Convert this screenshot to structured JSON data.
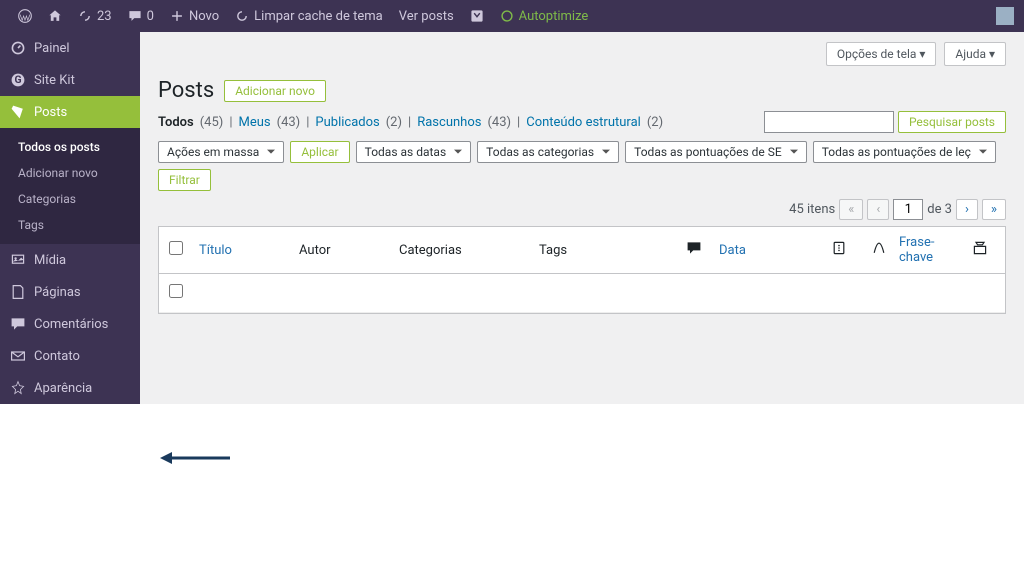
{
  "topbar": {
    "updates": "23",
    "comments": "0",
    "new": "Novo",
    "clear": "Limpar cache de tema",
    "view": "Ver posts",
    "auto": "Autoptimize"
  },
  "sidebar": {
    "dashboard": "Painel",
    "sitekit": "Site Kit",
    "posts": "Posts",
    "sub": {
      "all": "Todos os posts",
      "add": "Adicionar novo",
      "cat": "Categorias",
      "tags": "Tags"
    },
    "media": "Mídia",
    "pages": "Páginas",
    "comments": "Comentários",
    "contact": "Contato",
    "appearance": "Aparência"
  },
  "opt": {
    "screen": "Opções de tela ▾",
    "help": "Ajuda ▾"
  },
  "page": {
    "title": "Posts",
    "add": "Adicionar novo"
  },
  "filters": {
    "all": "Todos",
    "all_c": "(45)",
    "mine": "Meus",
    "mine_c": "(43)",
    "pub": "Publicados",
    "pub_c": "(2)",
    "draft": "Rascunhos",
    "draft_c": "(43)",
    "struct": "Conteúdo estrutural",
    "struct_c": "(2)"
  },
  "search": {
    "btn": "Pesquisar posts"
  },
  "actions": {
    "bulk": "Ações em massa",
    "apply": "Aplicar",
    "dates": "Todas as datas",
    "cats": "Todas as categorias",
    "seo": "Todas as pontuações de SE",
    "read": "Todas as pontuações de leç",
    "filter": "Filtrar"
  },
  "pgn": {
    "count": "45 itens",
    "page": "1",
    "of": "de 3"
  },
  "cols": {
    "title": "Título",
    "author": "Autor",
    "cats": "Categorias",
    "tags": "Tags",
    "date": "Data",
    "key": "Frase-chave"
  }
}
